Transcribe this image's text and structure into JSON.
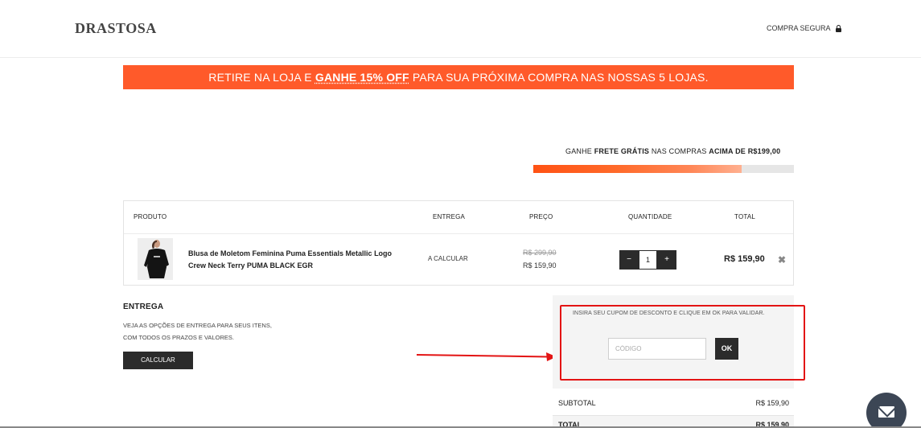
{
  "header": {
    "logo": "DRASTOSA",
    "secure_label": "COMPRA SEGURA"
  },
  "promo_banner": {
    "part1": "RETIRE NA LOJA E ",
    "highlight": "GANHE 15% OFF",
    "part2": " PARA SUA PRÓXIMA COMPRA NAS NOSSAS 5 LOJAS."
  },
  "free_shipping": {
    "part1": "GANHE ",
    "bold1": "FRETE GRÁTIS",
    "part2": " NAS COMPRAS ",
    "bold2": "ACIMA DE R$199,00",
    "progress_fraction": 0.8
  },
  "cart": {
    "headers": {
      "produto": "PRODUTO",
      "entrega": "ENTREGA",
      "preco": "PREÇO",
      "quantidade": "QUANTIDADE",
      "total": "TOTAL"
    },
    "item": {
      "name": "Blusa de Moletom Feminina Puma Essentials Metallic Logo Crew Neck Terry PUMA BLACK EGR",
      "delivery": "A CALCULAR",
      "old_price": "R$ 299,90",
      "price": "R$ 159,90",
      "quantity": "1",
      "total": "R$ 159,90",
      "decrement": "−",
      "increment": "+",
      "remove": "✖"
    }
  },
  "entrega_section": {
    "title": "ENTREGA",
    "line1": "VEJA AS OPÇÕES DE ENTREGA PARA SEUS ITENS,",
    "line2": "COM TODOS OS PRAZOS E VALORES.",
    "button": "CALCULAR"
  },
  "coupon": {
    "hint": "INSIRA SEU CUPOM DE DESCONTO E CLIQUE EM OK PARA VALIDAR.",
    "placeholder": "CÓDIGO",
    "button": "OK"
  },
  "summary": {
    "subtotal_label": "SUBTOTAL",
    "subtotal_value": "R$ 159,90",
    "total_label": "TOTAL",
    "total_value": "R$ 159,90"
  },
  "colors": {
    "accent": "#ff5a2a",
    "annotation": "#e31414",
    "dark_button": "#2b2b2b"
  },
  "icons": [
    "lock-icon",
    "remove-icon",
    "mail-icon",
    "arrow-annotation"
  ]
}
